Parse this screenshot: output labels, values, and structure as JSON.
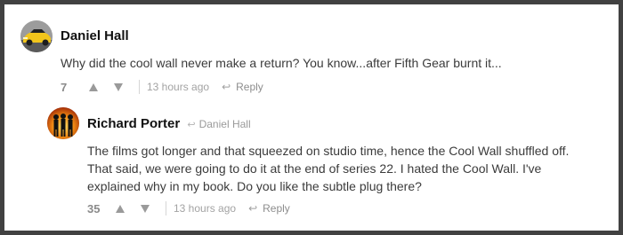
{
  "comments": [
    {
      "author": "Daniel Hall",
      "text_lines": [
        "Why did the cool wall never make a return? You know...after Fifth Gear burnt it..."
      ],
      "score": "7",
      "time": "13 hours ago",
      "reply_label": "Reply",
      "avatar_icon": "yellow-car-avatar"
    },
    {
      "author": "Richard Porter",
      "reply_to": "Daniel Hall",
      "text_lines": [
        "The films got longer and that squeezed on studio time, hence the Cool Wall shuffled off.",
        "That said, we were going to do it at the end of series 22. I hated the Cool Wall. I've",
        "explained why in my book. Do you like the subtle plug there?"
      ],
      "score": "35",
      "time": "13 hours ago",
      "reply_label": "Reply",
      "avatar_icon": "three-silhouettes-avatar"
    }
  ],
  "colors": {
    "frame": "#414141",
    "panel": "#ffffff",
    "author": "#111111",
    "text": "#3b3b3b",
    "meta": "#9b9b9b"
  }
}
